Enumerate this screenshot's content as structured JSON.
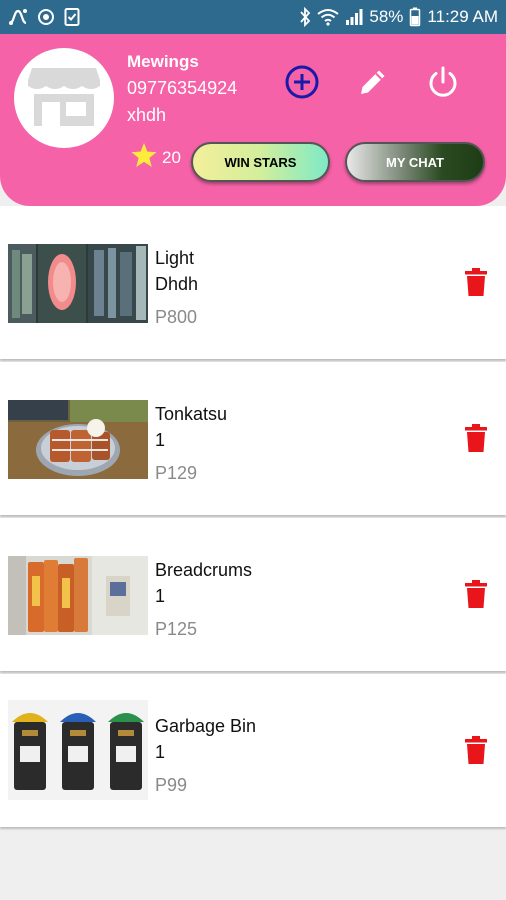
{
  "status_bar": {
    "icons_left": [
      "flow-icon",
      "sync-icon",
      "checklist-icon"
    ],
    "icons_right": [
      "bluetooth-icon",
      "wifi-icon",
      "signal-icon"
    ],
    "battery": "58%",
    "time": "11:29 AM",
    "bg_color": "#2e6a8e"
  },
  "header": {
    "bg_color": "#f562a8",
    "avatar_icon": "store-icon",
    "name": "Mewings",
    "phone": "09776354924",
    "meta": "xhdh",
    "star_count": "20",
    "actions": [
      "add-circle-icon",
      "edit-pencil-icon",
      "power-icon"
    ],
    "win_stars_label": "WIN STARS",
    "my_chat_label": "MY CHAT"
  },
  "products": [
    {
      "name": "Light",
      "desc": "Dhdh",
      "price": "P800",
      "image": "night-light-photo"
    },
    {
      "name": "Tonkatsu",
      "desc": "1",
      "price": "P129",
      "image": "tonkatsu-plate-photo"
    },
    {
      "name": "Breadcrums",
      "desc": "1",
      "price": "P125",
      "image": "breadcrumbs-packs-photo"
    },
    {
      "name": "Garbage Bin",
      "desc": "1",
      "price": "P99",
      "image": "garbage-bins-photo"
    }
  ],
  "colors": {
    "delete": "#e8161b",
    "add_icon": "#1a1aa8",
    "star": "#ffeb3b",
    "price": "#8a8a8a"
  }
}
